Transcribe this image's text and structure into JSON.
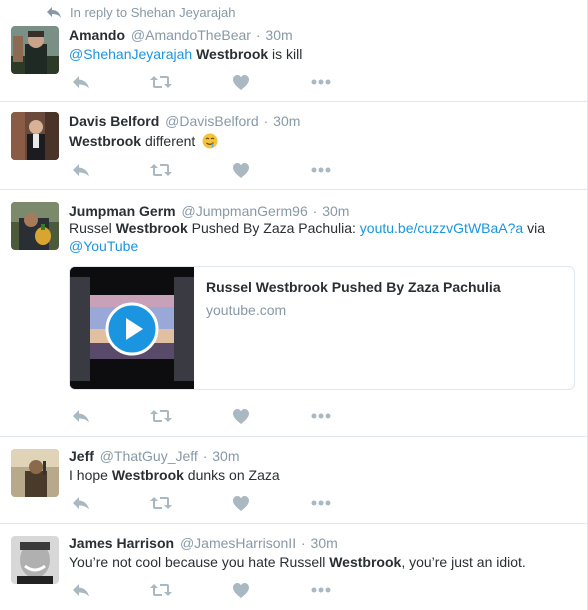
{
  "reply_context": {
    "text": "In reply to Shehan Jeyarajah",
    "icon": "reply-arrow-icon"
  },
  "tweets": [
    {
      "name": "Amando",
      "handle": "@AmandoTheBear",
      "sep": "·",
      "time": "30m",
      "text": {
        "mention": "@ShehanJeyarajah",
        "keyword": "Westbrook",
        "rest": " is kill"
      }
    },
    {
      "name": "Davis Belford",
      "handle": "@DavisBelford",
      "sep": "·",
      "time": "30m",
      "text": {
        "keyword": "Westbrook",
        "rest": " different",
        "emoji": "drooling-face-emoji"
      }
    },
    {
      "name": "Jumpman Germ",
      "handle": "@JumpmanGerm96",
      "sep": "·",
      "time": "30m",
      "text": {
        "pre": "Russel ",
        "keyword": "Westbrook",
        "mid": " Pushed By Zaza Pachulia: ",
        "link": "youtu.be/cuzzvGtWBaA?a",
        "via": " via",
        "mention": "@YouTube"
      },
      "card": {
        "title": "Russel Westbrook Pushed By Zaza Pachulia",
        "domain": "youtube.com",
        "play_icon": "play-button-icon"
      }
    },
    {
      "name": "Jeff",
      "handle": "@ThatGuy_Jeff",
      "sep": "·",
      "time": "30m",
      "text": {
        "pre": "I hope ",
        "keyword": "Westbrook",
        "rest": " dunks on Zaza"
      }
    },
    {
      "name": "James Harrison",
      "handle": "@JamesHarrisonII",
      "sep": "·",
      "time": "30m",
      "text": {
        "pre": "You’re not cool because you hate Russell ",
        "keyword": "Westbrook",
        "rest": ", you’re just an idiot."
      }
    }
  ],
  "actions": {
    "reply_icon": "reply-icon",
    "retweet_icon": "retweet-icon",
    "like_icon": "heart-icon",
    "more_icon": "more-dots-icon"
  },
  "colors": {
    "text": "#292f33",
    "muted": "#8899a6",
    "link": "#1b95e0",
    "icon": "#aab8c2",
    "divider": "#e1e8ed"
  }
}
